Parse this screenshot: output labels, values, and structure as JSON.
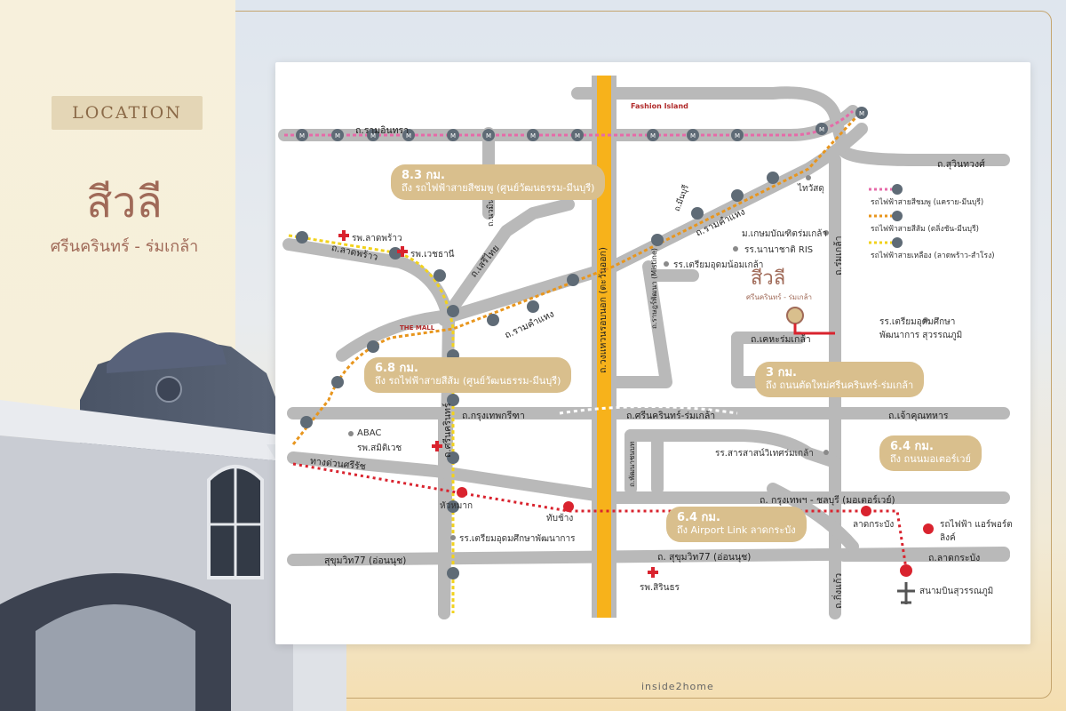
{
  "header": {
    "badge": "LOCATION",
    "title": "สีวลี",
    "subtitle": "ศรีนครินทร์ - ร่มเกล้า"
  },
  "roads": {
    "ramintra": "ถ.รามอินทรา",
    "suwinthawong": "ถ.สุวินทวงศ์",
    "ladprao": "ถ.ลาดพร้าว",
    "serithai": "ถ.เสรีไทย",
    "ramkhamhaeng_w": "ถ.รามคำแหง",
    "ramkhamhaeng_e": "ถ.รามคำแหง",
    "kanchanaphisek": "ถ.วงแหวนรอบนอก (ตะวันออก)",
    "romklao": "ถ.ร่มเกล้า",
    "krungthepkreetha": "ถ.กรุงเทพกรีฑา",
    "srinakarin_romklao": "ถ.ศรีนครินทร์-ร่มเกล้า",
    "chaokhunthahan": "ถ.เจ้าคุณทหาร",
    "srinakarin": "ถ.ศรีนครินทร์",
    "expressway": "ทางด่วนศรีรัช",
    "motorway": "ถ. กรุงเทพฯ - ชลบุรี (มอเตอร์เวย์)",
    "sukhumvit77_w": "สุขุมวิท77 (อ่อนนุช)",
    "sukhumvit77_e": "ถ. สุขุมวิท77 (อ่อนนุช)",
    "ladkrabang": "ถ.ลาดกระบัง",
    "kingkaew": "ถ.กิ่งแก้ว",
    "kehromklao": "ถ.เคหะร่มเกล้า",
    "rat_phatthana": "ถ.ราษฎร์พัฒนา (Mistine)",
    "minburi": "ถ.มีนบุรี",
    "phatthanachonnabot": "ถ.พัฒนาชนบท",
    "nawamin": "ถ.นวมินทร์"
  },
  "places": {
    "fashion_island": "Fashion Island",
    "thai_watsadu": "ไทวัสดุ",
    "kaset_bundit": "ม.เกษมบัณฑิตร่มเกล้า",
    "ris": "รร.นานาชาติ RIS",
    "triam_noi": "รร.เตรียมอุดมน้อมเกล้า",
    "triam_phatthanakan_n": "รร.เตรียมอุดมศึกษา พัฒนาการ สุวรรณภูมิ",
    "ladprao_hosp": "รพ.ลาดพร้าว",
    "vejthani": "รพ.เวชธานี",
    "the_mall": "THE MALL",
    "abac": "ABAC",
    "samitivej": "รพ.สมิติเวช",
    "huamak": "หัวหมาก",
    "thapchang": "ทับช้าง",
    "triam_phatthanakan": "รร.เตรียมอุดมศึกษาพัฒนาการ",
    "sarasas": "รร.สารสาสน์วิเทศร่มเกล้า",
    "sirinthorn": "รพ.สิรินธร",
    "ladkrabang_st": "ลาดกระบัง",
    "arl_train": "รถไฟฟ้า แอร์พอร์ตลิงค์",
    "suvarnabhumi": "สนามบินสุวรรณภูมิ",
    "project_name": "สีวลี",
    "project_sub": "ศรีนครินทร์ - ร่มเกล้า"
  },
  "callouts": {
    "pink": {
      "dist": "8.3 กม.",
      "text": "ถึง รถไฟฟ้าสายสีชมพู (ศูนย์วัฒนธรรม-มีนบุรี)"
    },
    "orange": {
      "dist": "6.8 กม.",
      "text": "ถึง รถไฟฟ้าสายสีส้ม (ศูนย์วัฒนธรรม-มีนบุรี)"
    },
    "newroad": {
      "dist": "3 กม.",
      "text": "ถึง ถนนตัดใหม่ศรีนครินทร์-ร่มเกล้า"
    },
    "motorway": {
      "dist": "6.4 กม.",
      "text": "ถึง ถนนมอเตอร์เวย์"
    },
    "arl": {
      "dist": "6.4 กม.",
      "text": "ถึง Airport Link ลาดกระบัง"
    }
  },
  "legend": [
    {
      "label": "รถไฟฟ้าสายสีชมพู (แคราย-มีนบุรี)",
      "color": "#e66aa8"
    },
    {
      "label": "รถไฟฟ้าสายสีส้ม (ตลิ่งชัน-มีนบุรี)",
      "color": "#e8961e"
    },
    {
      "label": "รถไฟฟ้าสายเหลือง (ลาดพร้าว-สำโรง)",
      "color": "#f2d21c"
    }
  ],
  "colors": {
    "road": "#b9b9b9",
    "highway": "#f7b21b",
    "pink_line": "#e66aa8",
    "orange_line": "#e8961e",
    "yellow_line": "#f2d21c",
    "arl_line": "#d9232e",
    "metro_marker": "#5f6b76",
    "callout": "#d9bf8d",
    "brand": "#a06a58"
  },
  "credit": "inside2home"
}
